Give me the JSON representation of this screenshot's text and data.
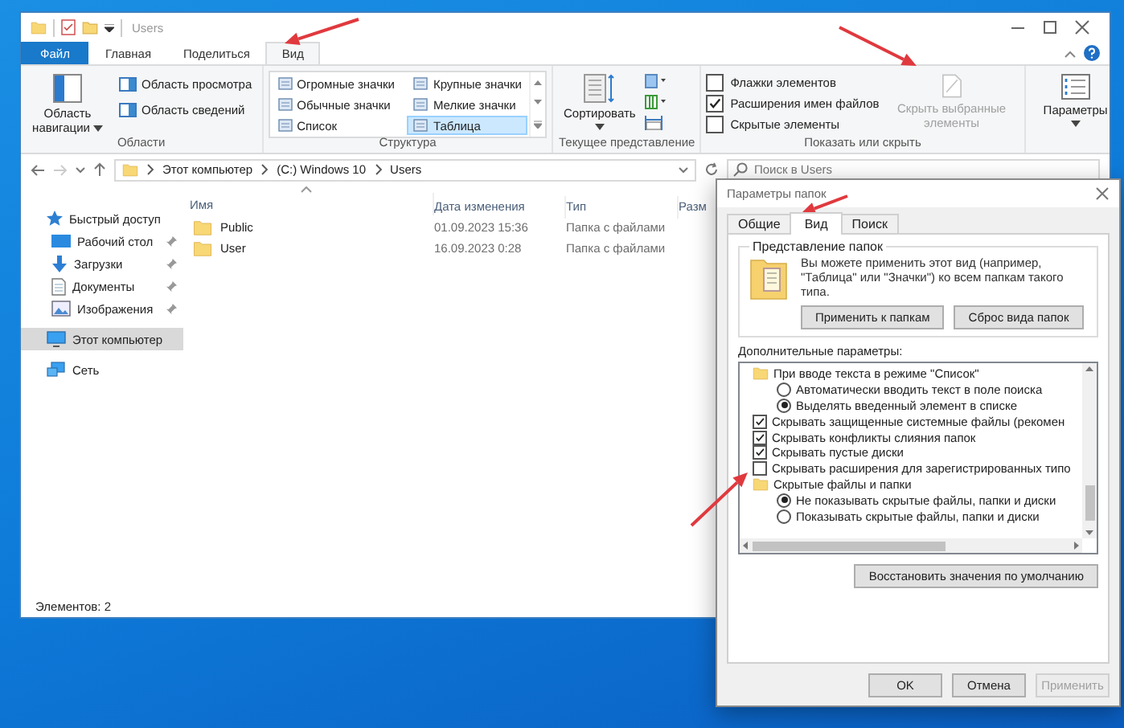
{
  "explorer": {
    "title": "Users",
    "ribbon_tabs": [
      {
        "label": "Файл",
        "kind": "file",
        "selected": false
      },
      {
        "label": "Главная",
        "kind": "tab",
        "selected": false
      },
      {
        "label": "Поделиться",
        "kind": "tab",
        "selected": false
      },
      {
        "label": "Вид",
        "kind": "tab",
        "selected": true
      }
    ],
    "ribbon": {
      "panes": {
        "name": "Области",
        "navigation_pane": "Область навигации",
        "preview_pane": "Область просмотра",
        "details_pane": "Область сведений"
      },
      "layout": {
        "name": "Структура",
        "options": [
          {
            "label": "Огромные значки",
            "selected": false
          },
          {
            "label": "Крупные значки",
            "selected": false
          },
          {
            "label": "Обычные значки",
            "selected": false
          },
          {
            "label": "Мелкие значки",
            "selected": false
          },
          {
            "label": "Список",
            "selected": false
          },
          {
            "label": "Таблица",
            "selected": true
          }
        ]
      },
      "current_view": {
        "name": "Текущее представление",
        "sort_button": "Сортировать"
      },
      "show_hide": {
        "name": "Показать или скрыть",
        "checkboxes": [
          {
            "label": "Флажки элементов",
            "checked": false
          },
          {
            "label": "Расширения имен файлов",
            "checked": true
          },
          {
            "label": "Скрытые элементы",
            "checked": false
          }
        ],
        "hide_selected": {
          "label": "Скрыть выбранные элементы",
          "disabled": true
        }
      },
      "options_button": "Параметры"
    },
    "address": {
      "path": [
        "Этот компьютер",
        "(C:) Windows 10",
        "Users"
      ],
      "search_placeholder": "Поиск в Users"
    },
    "nav": [
      {
        "label": "Быстрый доступ",
        "kind": "star",
        "selected": false,
        "children": [
          {
            "label": "Рабочий стол",
            "kind": "desktop",
            "pinned": true,
            "selected": false
          },
          {
            "label": "Загрузки",
            "kind": "download",
            "pinned": true,
            "selected": false
          },
          {
            "label": "Документы",
            "kind": "document",
            "pinned": true,
            "selected": false
          },
          {
            "label": "Изображения",
            "kind": "pictures",
            "pinned": true,
            "selected": false
          }
        ]
      },
      {
        "label": "Этот компьютер",
        "kind": "computer",
        "selected": true
      },
      {
        "label": "Сеть",
        "kind": "network",
        "selected": false
      }
    ],
    "columns": [
      "Имя",
      "Дата изменения",
      "Тип",
      "Разм"
    ],
    "rows": [
      {
        "name": "Public",
        "date": "01.09.2023 15:36",
        "type": "Папка с файлами"
      },
      {
        "name": "User",
        "date": "16.09.2023 0:28",
        "type": "Папка с файлами"
      }
    ],
    "status": "Элементов: 2"
  },
  "dialog": {
    "title": "Параметры папок",
    "tabs": [
      {
        "label": "Общие",
        "selected": false
      },
      {
        "label": "Вид",
        "selected": true
      },
      {
        "label": "Поиск",
        "selected": false
      }
    ],
    "folder_views": {
      "title": "Представление папок",
      "description": "Вы можете применить этот вид (например, \"Таблица\" или \"Значки\") ко всем папкам такого типа.",
      "buttons": [
        "Применить к папкам",
        "Сброс вида папок"
      ]
    },
    "advanced_label": "Дополнительные параметры:",
    "advanced": [
      {
        "kind": "folder",
        "label": "При вводе текста в режиме \"Список\"",
        "children": [
          {
            "kind": "radio",
            "label": "Автоматически вводить текст в поле поиска",
            "checked": false
          },
          {
            "kind": "radio",
            "label": "Выделять введенный элемент в списке",
            "checked": true
          }
        ]
      },
      {
        "kind": "checkbox",
        "label": "Скрывать защищенные системные файлы (рекомен",
        "checked": true
      },
      {
        "kind": "checkbox",
        "label": "Скрывать конфликты слияния папок",
        "checked": true
      },
      {
        "kind": "checkbox",
        "label": "Скрывать пустые диски",
        "checked": true
      },
      {
        "kind": "checkbox",
        "label": "Скрывать расширения для зарегистрированных типо",
        "checked": false
      },
      {
        "kind": "folder",
        "label": "Скрытые файлы и папки",
        "children": [
          {
            "kind": "radio",
            "label": "Не показывать скрытые файлы, папки и диски",
            "checked": true
          },
          {
            "kind": "radio",
            "label": "Показывать скрытые файлы, папки и диски",
            "checked": false
          }
        ]
      }
    ],
    "restore_button": "Восстановить значения по умолчанию",
    "buttons": [
      {
        "label": "OK",
        "disabled": false
      },
      {
        "label": "Отмена",
        "disabled": false
      },
      {
        "label": "Применить",
        "disabled": true
      }
    ]
  }
}
